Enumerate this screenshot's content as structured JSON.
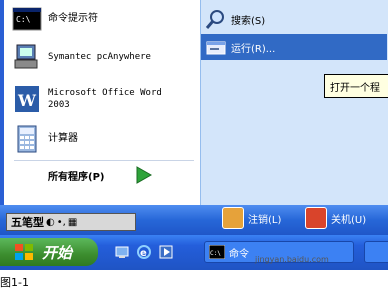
{
  "start_menu": {
    "left_items": [
      {
        "label": "命令提示符",
        "icon": "cmd-icon"
      },
      {
        "label": "Symantec pcAnywhere",
        "icon": "pcanywhere-icon"
      },
      {
        "label": "Microsoft Office Word 2003",
        "icon": "word-icon"
      },
      {
        "label": "计算器",
        "icon": "calculator-icon"
      }
    ],
    "all_programs": "所有程序(P)",
    "right_items": [
      {
        "label": "搜索(S)",
        "icon": "search-icon"
      },
      {
        "label": "运行(R)...",
        "icon": "run-icon"
      }
    ],
    "logoff_label": "注销(L)",
    "shutdown_label": "关机(U)"
  },
  "tooltip": "打开一个程",
  "ime": {
    "label": "五笔型"
  },
  "taskbar": {
    "start_label": "开始",
    "task_label": "命令"
  },
  "caption": "图1-1",
  "watermark": "jingyan.baidu.com",
  "colors": {
    "menu_blue": "#d3e5fa",
    "taskbar_blue": "#245edb",
    "start_green": "#3c8d2e",
    "highlight": "#316ac5"
  }
}
